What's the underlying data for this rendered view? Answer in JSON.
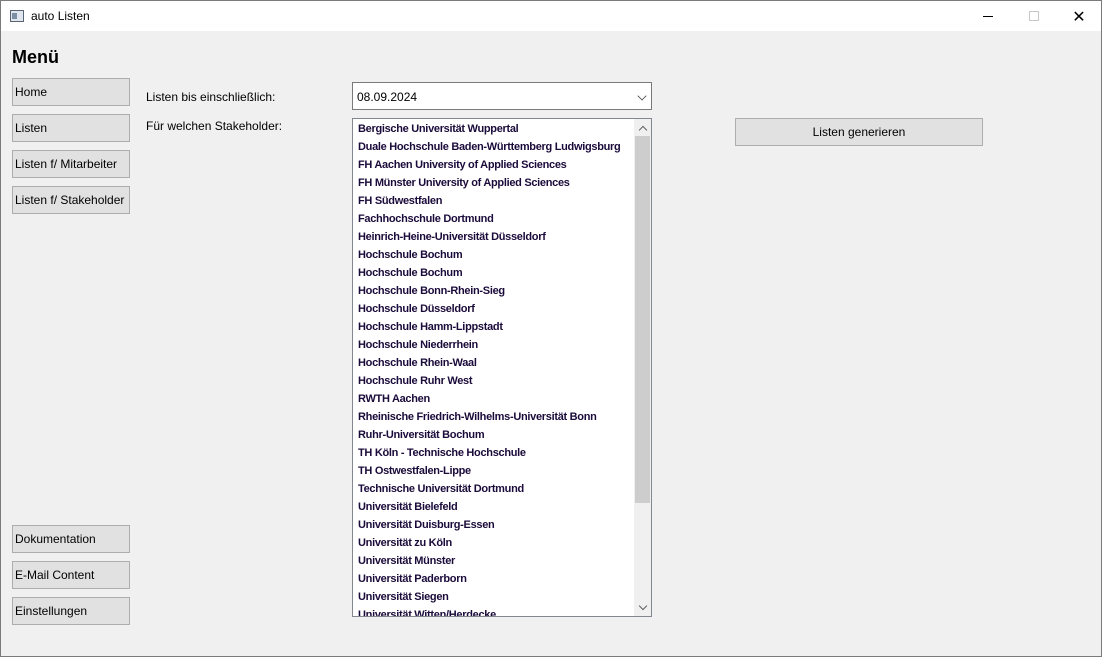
{
  "window": {
    "title": "auto Listen",
    "minimize_label": "—",
    "close_label": "✕"
  },
  "sidebar": {
    "heading": "Menü",
    "top_items": [
      "Home",
      "Listen",
      "Listen f/ Mitarbeiter",
      "Listen f/ Stakeholder"
    ],
    "bottom_items": [
      "Dokumentation",
      "E-Mail Content",
      "Einstellungen"
    ]
  },
  "form": {
    "date_label": "Listen bis einschließlich:",
    "date_value": "08.09.2024",
    "stakeholder_label": "Für welchen Stakeholder:",
    "stakeholders": [
      "Bergische Universität Wuppertal",
      "Duale Hochschule Baden-Württemberg Ludwigsburg",
      "FH Aachen University of Applied Sciences",
      "FH Münster University of Applied Sciences",
      "FH Südwestfalen",
      "Fachhochschule Dortmund",
      "Heinrich-Heine-Universität Düsseldorf",
      "Hochschule Bochum",
      "Hochschule Bochum",
      "Hochschule Bonn-Rhein-Sieg",
      "Hochschule Düsseldorf",
      "Hochschule Hamm-Lippstadt",
      "Hochschule Niederrhein",
      "Hochschule Rhein-Waal",
      "Hochschule Ruhr West",
      "RWTH Aachen",
      "Rheinische Friedrich-Wilhelms-Universität Bonn",
      "Ruhr-Universität Bochum",
      "TH Köln - Technische Hochschule",
      "TH Ostwestfalen-Lippe",
      "Technische Universität Dortmund",
      "Universität Bielefeld",
      "Universität Duisburg-Essen",
      "Universität zu Köln",
      "Universität Münster",
      "Universität Paderborn",
      "Universität Siegen",
      "Universität Witten/Herdecke"
    ],
    "generate_button": "Listen generieren"
  },
  "colors": {
    "accent": "#e1e1e1",
    "list_text": "#1b0b3a"
  },
  "icons": {
    "app": "app-window-icon",
    "combo": "chevron-down-icon"
  }
}
